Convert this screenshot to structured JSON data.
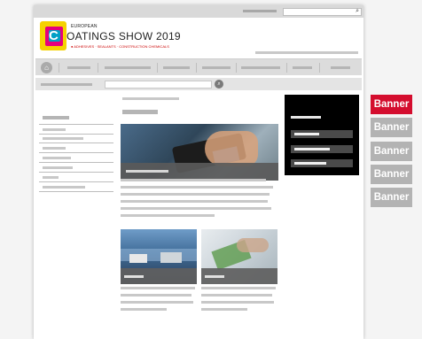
{
  "logo": {
    "small_text": "EUROPEAN",
    "main_text": "OATINGS SHOW 2019",
    "c_letter": "C",
    "tagline": "● ADHESIVES · SEALANTS · CONSTRUCTION CHEMICALS"
  },
  "icons": {
    "search": "search-icon",
    "home": "home-icon"
  },
  "banners": [
    {
      "label": "Banner",
      "active": true
    },
    {
      "label": "Banner",
      "active": false
    },
    {
      "label": "Banner",
      "active": false
    },
    {
      "label": "Banner",
      "active": false
    },
    {
      "label": "Banner",
      "active": false
    }
  ],
  "colors": {
    "banner_active": "#d40d2e",
    "banner_inactive": "#b3b3b3",
    "blackbox": "#000000"
  }
}
